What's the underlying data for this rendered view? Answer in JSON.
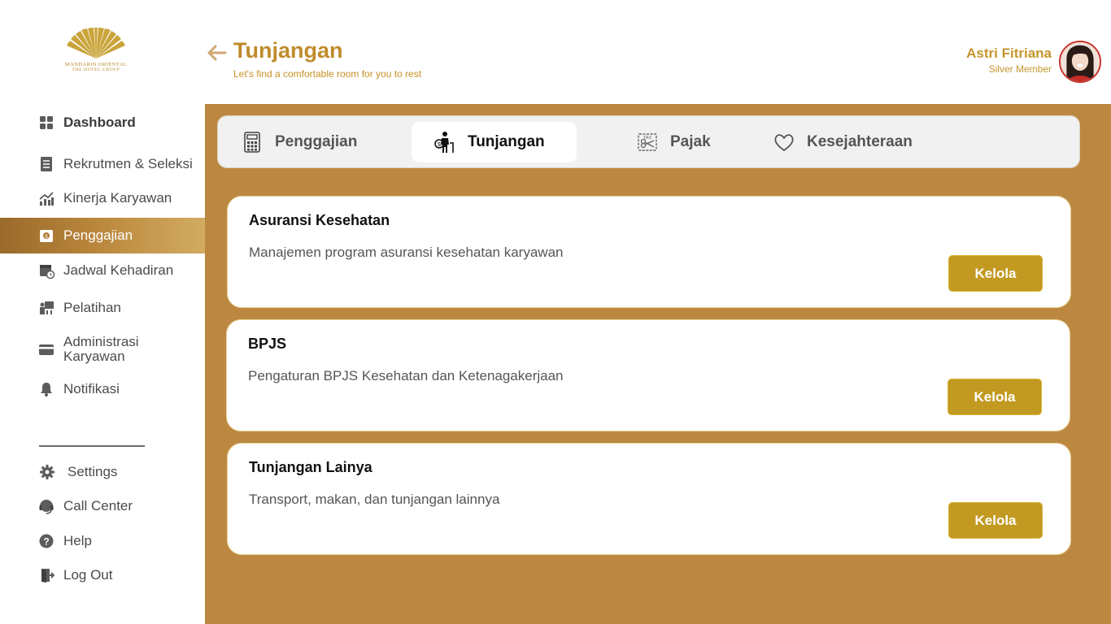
{
  "brand": {
    "name": "MANDARIN ORIENTAL",
    "subtitle": "THE HOTEL GROUP"
  },
  "header": {
    "title": "Tunjangan",
    "subtitle": "Let's find a comfortable room for you to rest"
  },
  "user": {
    "name": "Astri Fitriana",
    "level": "Silver Member"
  },
  "sidebar": {
    "items": [
      {
        "label": "Dashboard",
        "icon": "grid-icon"
      },
      {
        "label": "Rekrutmen & Seleksi",
        "icon": "document-list-icon"
      },
      {
        "label": "Kinerja Karyawan",
        "icon": "trend-chart-icon"
      },
      {
        "label": "Penggajian",
        "icon": "payroll-icon",
        "active": true
      },
      {
        "label": "Jadwal Kehadiran",
        "icon": "calendar-clock-icon"
      },
      {
        "label": "Pelatihan",
        "icon": "training-icon"
      },
      {
        "label": "Administrasi Karyawan",
        "icon": "card-icon"
      },
      {
        "label": "Notifikasi",
        "icon": "bell-icon"
      }
    ],
    "bottom_items": [
      {
        "label": "Settings",
        "icon": "gear-icon"
      },
      {
        "label": "Call Center",
        "icon": "headset-icon"
      },
      {
        "label": "Help",
        "icon": "help-icon"
      },
      {
        "label": "Log Out",
        "icon": "logout-icon"
      }
    ]
  },
  "tabs": [
    {
      "label": "Penggajian",
      "icon": "calculator-icon"
    },
    {
      "label": "Tunjangan",
      "icon": "elderly-support-icon",
      "active": true
    },
    {
      "label": "Pajak",
      "icon": "tax-icon"
    },
    {
      "label": "Kesejahteraan",
      "icon": "heart-icon"
    }
  ],
  "cards": [
    {
      "title": "Asuransi Kesehatan",
      "description": "Manajemen program asuransi kesehatan karyawan",
      "button": "Kelola"
    },
    {
      "title": "BPJS",
      "description": "Pengaturan BPJS Kesehatan dan Ketenagakerjaan",
      "button": "Kelola"
    },
    {
      "title": "Tunjangan Lainya",
      "description": "Transport, makan, dan tunjangan lainnya",
      "button": "Kelola"
    }
  ],
  "colors": {
    "accent": "#c29a22",
    "main_background": "#bc8841",
    "title_gold": "#c08b2c"
  }
}
